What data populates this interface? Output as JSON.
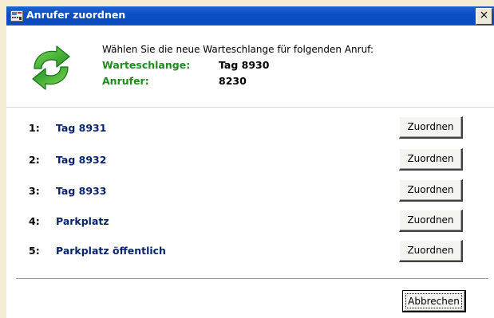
{
  "window": {
    "title": "Anrufer zuordnen",
    "close_label": "×"
  },
  "header": {
    "prompt": "Wählen Sie die neue Warteschlange für folgenden Anruf:",
    "queue_label": "Warteschlange:",
    "queue_value": "Tag 8930",
    "caller_label": "Anrufer:",
    "caller_value": "8230"
  },
  "queues": [
    {
      "number": "1:",
      "name": "Tag 8931",
      "button_label": "Zuordnen"
    },
    {
      "number": "2:",
      "name": "Tag 8932",
      "button_label": "Zuordnen"
    },
    {
      "number": "3:",
      "name": "Tag 8933",
      "button_label": "Zuordnen"
    },
    {
      "number": "4:",
      "name": "Parkplatz",
      "button_label": "Zuordnen"
    },
    {
      "number": "5:",
      "name": "Parkplatz öffentlich",
      "button_label": "Zuordnen"
    }
  ],
  "footer": {
    "cancel_label": "Abbrechen"
  },
  "colors": {
    "titlebar": "#0a4ac0",
    "label_green": "#1f8a1f",
    "queue_blue": "#0a246a",
    "icon_green": "#2aa52a"
  },
  "icons": {
    "title_icon": "phone-app-icon",
    "big_icon": "transfer-arrows-icon"
  }
}
